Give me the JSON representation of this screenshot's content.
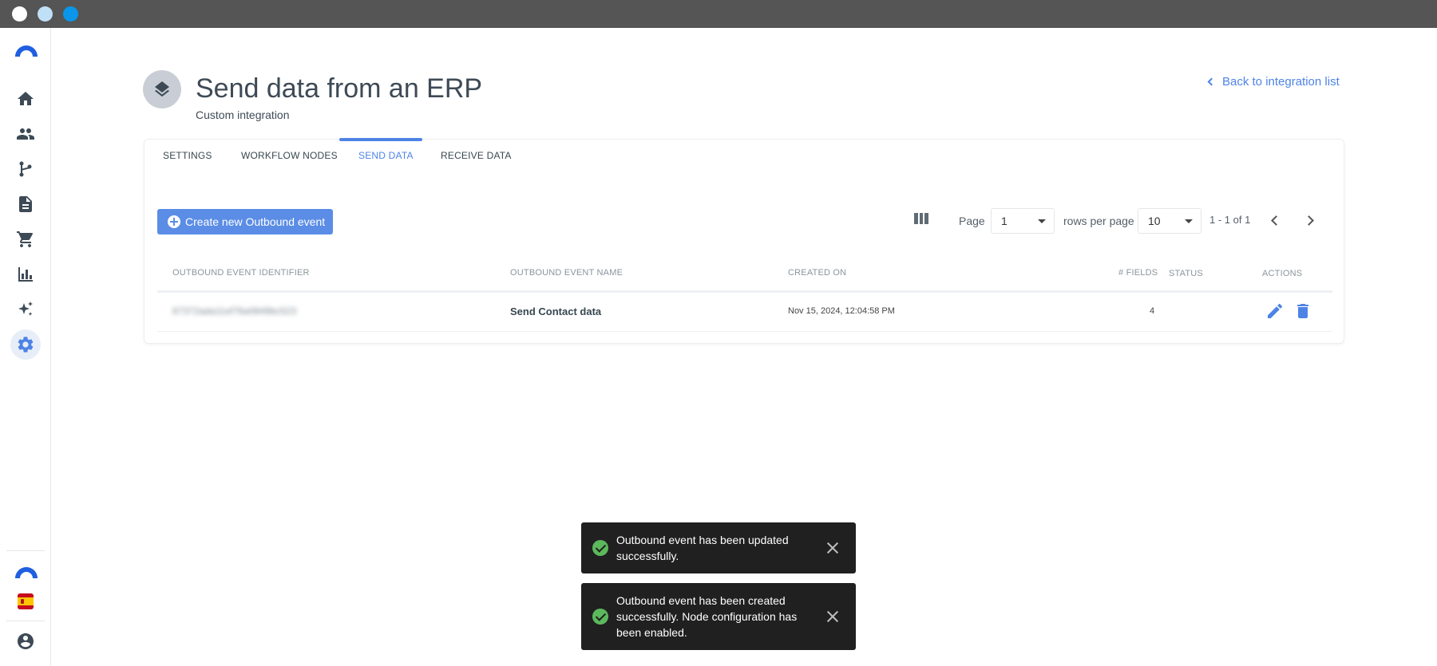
{
  "sidebar": {
    "items": [
      {
        "name": "home-icon"
      },
      {
        "name": "people-icon"
      },
      {
        "name": "workflow-icon"
      },
      {
        "name": "document-icon"
      },
      {
        "name": "cart-icon"
      },
      {
        "name": "bar-chart-icon"
      },
      {
        "name": "sparkles-icon"
      },
      {
        "name": "gear-icon",
        "active": true
      }
    ],
    "bottom": [
      {
        "name": "brand-logo-icon"
      },
      {
        "name": "spain-flag-icon"
      },
      {
        "name": "account-circle-icon"
      }
    ],
    "accent_color": "#4e83e6"
  },
  "header": {
    "title": "Send data from an ERP",
    "subtitle": "Custom integration",
    "back_link": "Back to integration list"
  },
  "tabs": [
    {
      "label": "SETTINGS"
    },
    {
      "label": "WORKFLOW NODES"
    },
    {
      "label": "SEND DATA",
      "active": true
    },
    {
      "label": "RECEIVE DATA"
    }
  ],
  "toolbar": {
    "create_label": "Create new Outbound event",
    "page_label": "Page",
    "page_value": "1",
    "rows_label": "rows per page",
    "rows_value": "10",
    "range_text": "1 - 1 of 1"
  },
  "table": {
    "headers": [
      "OUTBOUND EVENT IDENTIFIER",
      "OUTBOUND EVENT NAME",
      "CREATED ON",
      "# FIELDS",
      "STATUS",
      "ACTIONS"
    ],
    "rows": [
      {
        "identifier": "67372ada11ef76a0849bc523",
        "name": "Send Contact data",
        "created_on": "Nov 15, 2024, 12:04:58 PM",
        "fields": "4",
        "status": ""
      }
    ]
  },
  "toasts": [
    {
      "message": "Outbound event has been updated successfully.",
      "status_color": "#5cb85c"
    },
    {
      "message": "Outbound event has been created successfully. Node configuration has been enabled.",
      "status_color": "#5cb85c"
    }
  ],
  "colors": {
    "primary": "#4e83e6",
    "button": "#5b8de6",
    "toast_bg": "#202020",
    "success": "#5cb85c"
  }
}
